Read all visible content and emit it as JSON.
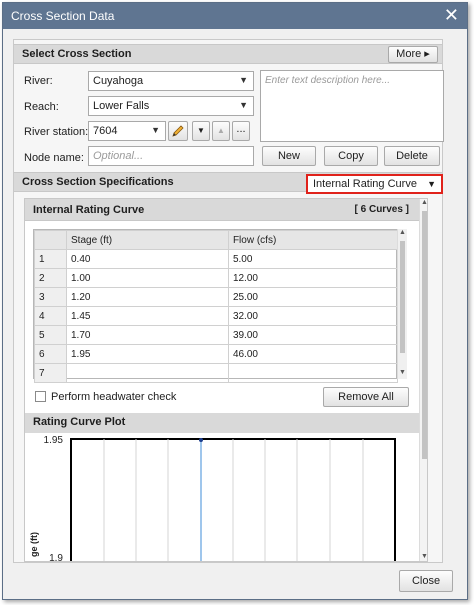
{
  "window": {
    "title": "Cross Section Data",
    "close_glyph": "✕"
  },
  "select_section": {
    "header": "Select Cross Section",
    "more_label": "More ▸",
    "river_label": "River:",
    "river_value": "Cuyahoga",
    "reach_label": "Reach:",
    "reach_value": "Lower Falls",
    "station_label": "River station:",
    "station_value": "7604",
    "node_label": "Node name:",
    "node_placeholder": "Optional...",
    "description_placeholder": "Enter text description here...",
    "new_label": "New",
    "copy_label": "Copy",
    "delete_label": "Delete",
    "ellipsis_label": "..."
  },
  "specs": {
    "header": "Cross Section Specifications",
    "type_value": "Internal Rating Curve"
  },
  "rating_curve": {
    "header": "Internal Rating Curve",
    "count_label": "[ 6 Curves ]",
    "columns": [
      "Stage (ft)",
      "Flow (cfs)"
    ],
    "rows": [
      {
        "n": "1",
        "stage": "0.40",
        "flow": "5.00"
      },
      {
        "n": "2",
        "stage": "1.00",
        "flow": "12.00"
      },
      {
        "n": "3",
        "stage": "1.20",
        "flow": "25.00"
      },
      {
        "n": "4",
        "stage": "1.45",
        "flow": "32.00"
      },
      {
        "n": "5",
        "stage": "1.70",
        "flow": "39.00"
      },
      {
        "n": "6",
        "stage": "1.95",
        "flow": "46.00"
      },
      {
        "n": "7",
        "stage": "",
        "flow": ""
      }
    ],
    "headwater_label": "Perform headwater check",
    "headwater_checked": false,
    "remove_all_label": "Remove All"
  },
  "plot": {
    "header": "Rating Curve Plot",
    "y_top_label": "1.95",
    "y_bottom_label": "1.9",
    "y_axis_label": "ge (ft)"
  },
  "footer": {
    "close_label": "Close"
  },
  "colors": {
    "titlebar": "#5f7591",
    "highlight": "#e0221b",
    "curve": "#7fb2e5"
  }
}
